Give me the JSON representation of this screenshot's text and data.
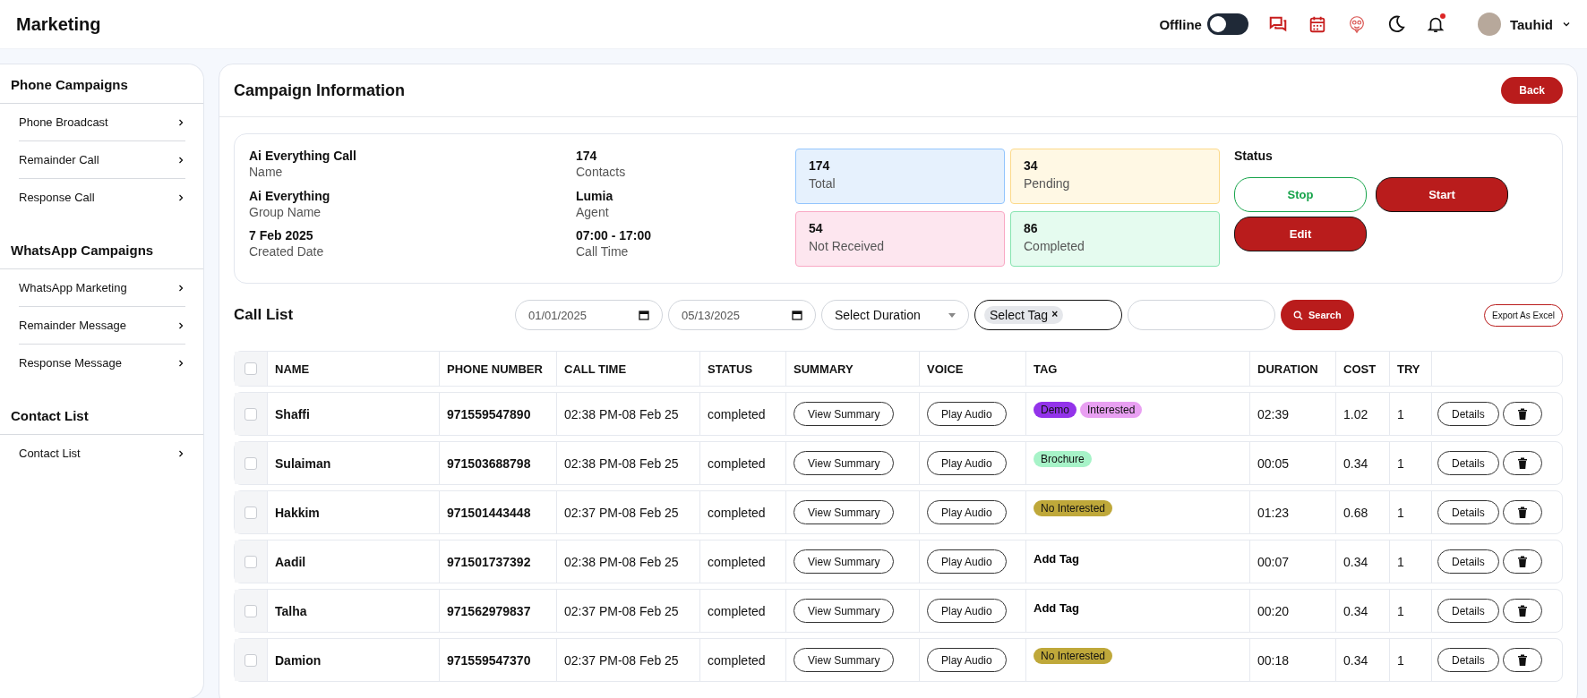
{
  "header": {
    "title": "Marketing",
    "presence": {
      "label": "Offline",
      "on": false
    },
    "notifications": {
      "unread": true
    },
    "user": {
      "name": "Tauhid"
    }
  },
  "sidebar": {
    "sections": [
      {
        "title": "Phone Campaigns",
        "items": [
          "Phone Broadcast",
          "Remainder Call",
          "Response Call"
        ]
      },
      {
        "title": "WhatsApp Campaigns",
        "items": [
          "WhatsApp Marketing",
          "Remainder Message",
          "Response Message"
        ]
      },
      {
        "title": "Contact List",
        "items": [
          "Contact List"
        ]
      }
    ]
  },
  "campaign": {
    "title": "Campaign Information",
    "back": "Back",
    "fields": [
      {
        "value": "Ai Everything Call",
        "label": "Name"
      },
      {
        "value": "Ai Everything",
        "label": "Group Name"
      },
      {
        "value": "7 Feb 2025",
        "label": "Created Date"
      },
      {
        "value": "174",
        "label": "Contacts"
      },
      {
        "value": "Lumia",
        "label": "Agent"
      },
      {
        "value": "07:00 - 17:00",
        "label": "Call Time"
      }
    ],
    "stats": [
      {
        "kind": "total",
        "value": "174",
        "label": "Total"
      },
      {
        "kind": "pending",
        "value": "34",
        "label": "Pending"
      },
      {
        "kind": "failed",
        "value": "54",
        "label": "Not Received"
      },
      {
        "kind": "done",
        "value": "86",
        "label": "Completed"
      }
    ],
    "status": {
      "title": "Status",
      "buttons": [
        {
          "kind": "outline",
          "label": "Stop"
        },
        {
          "kind": "filled",
          "label": "Start"
        },
        {
          "kind": "filled",
          "label": "Edit"
        }
      ]
    }
  },
  "call_list": {
    "title": "Call List",
    "filters": {
      "from": "01/01/2025",
      "to": "05/13/2025",
      "duration": "Select Duration",
      "tag_chip": "Select Tag",
      "tag_remove": "×",
      "search": "Search",
      "export": "Export As Excel"
    },
    "select_all_checked": false,
    "columns": [
      "NAME",
      "PHONE NUMBER",
      "CALL TIME",
      "STATUS",
      "SUMMARY",
      "VOICE",
      "TAG",
      "DURATION",
      "COST",
      "TRY"
    ],
    "rows": [
      {
        "checked": false,
        "name": "Shaffi",
        "phone": "971559547890",
        "call_time": "02:38 PM-08 Feb 25",
        "status": "completed",
        "summary": "View Summary",
        "voice": "Play Audio",
        "tags": [
          {
            "label": "Demo",
            "color": "#9333ea"
          },
          {
            "label": "Interested",
            "color": "#e9a0f2"
          }
        ],
        "duration": "02:39",
        "cost": "1.02",
        "try": "1",
        "details": "Details"
      },
      {
        "checked": false,
        "name": "Sulaiman",
        "phone": "971503688798",
        "call_time": "02:38 PM-08 Feb 25",
        "status": "completed",
        "summary": "View Summary",
        "voice": "Play Audio",
        "tags": [
          {
            "label": "Brochure",
            "color": "#a7f3c8"
          }
        ],
        "duration": "00:05",
        "cost": "0.34",
        "try": "1",
        "details": "Details"
      },
      {
        "checked": false,
        "name": "Hakkim",
        "phone": "971501443448",
        "call_time": "02:37 PM-08 Feb 25",
        "status": "completed",
        "summary": "View Summary",
        "voice": "Play Audio",
        "tags": [
          {
            "label": "No Interested",
            "color": "#bfa83a"
          }
        ],
        "duration": "01:23",
        "cost": "0.68",
        "try": "1",
        "details": "Details"
      },
      {
        "checked": false,
        "name": "Aadil",
        "phone": "971501737392",
        "call_time": "02:38 PM-08 Feb 25",
        "status": "completed",
        "summary": "View Summary",
        "voice": "Play Audio",
        "add_tag": "Add Tag",
        "duration": "00:07",
        "cost": "0.34",
        "try": "1",
        "details": "Details"
      },
      {
        "checked": false,
        "name": "Talha",
        "phone": "971562979837",
        "call_time": "02:37 PM-08 Feb 25",
        "status": "completed",
        "summary": "View Summary",
        "voice": "Play Audio",
        "add_tag": "Add Tag",
        "duration": "00:20",
        "cost": "0.34",
        "try": "1",
        "details": "Details"
      },
      {
        "checked": false,
        "name": "Damion",
        "phone": "971559547370",
        "call_time": "02:37 PM-08 Feb 25",
        "status": "completed",
        "summary": "View Summary",
        "voice": "Play Audio",
        "tags": [
          {
            "label": "No Interested",
            "color": "#bfa83a"
          }
        ],
        "duration": "00:18",
        "cost": "0.34",
        "try": "1",
        "details": "Details"
      }
    ]
  }
}
